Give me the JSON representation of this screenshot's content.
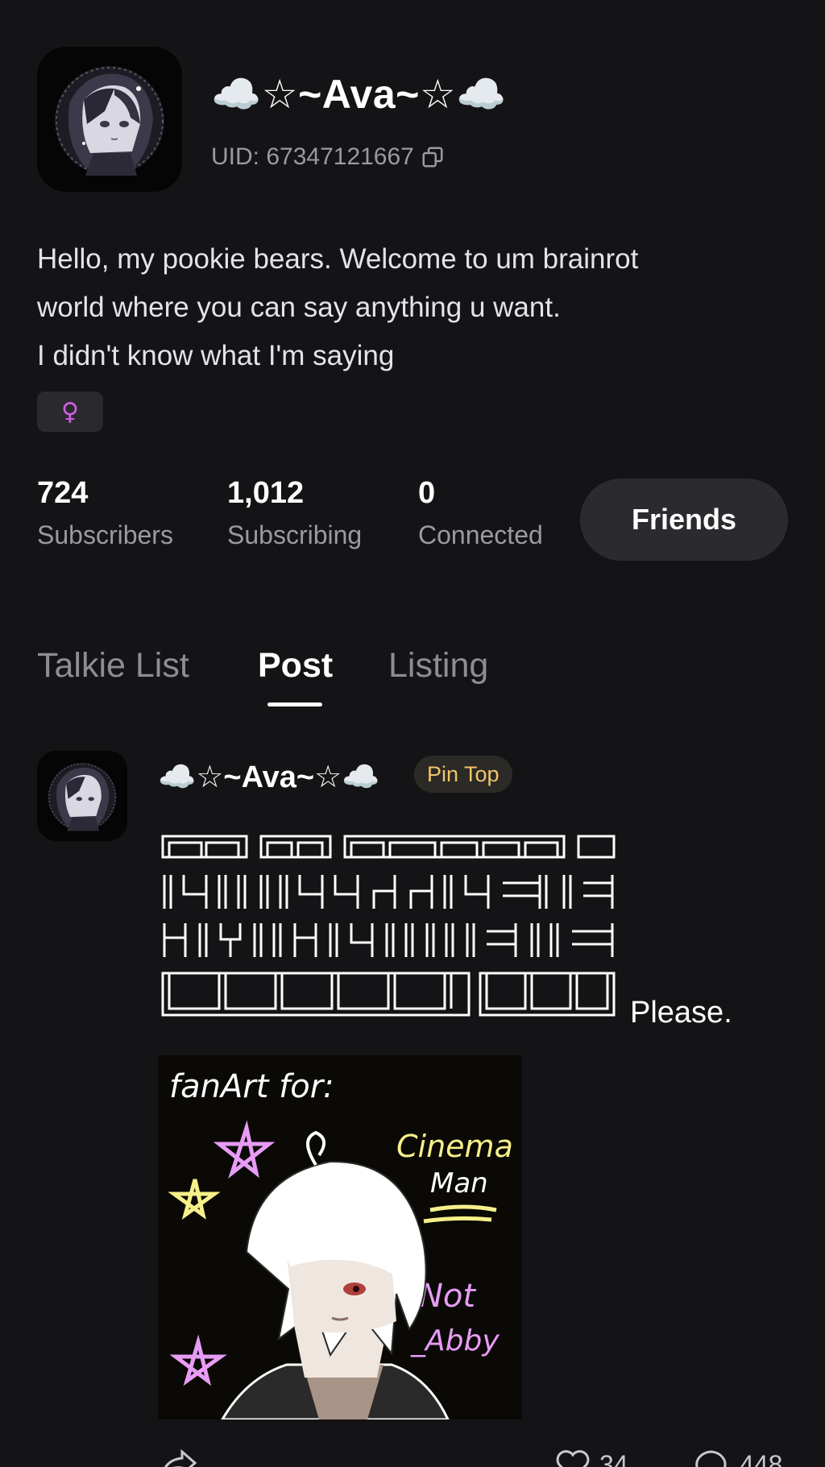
{
  "profile": {
    "username": "☁️☆~Ava~☆☁️",
    "uid": "UID: 67347121667",
    "bio_lines": [
      "Hello, my pookie bears. Welcome to um brainrot",
      "world where you can say anything u want.",
      "I didn't know what I'm saying"
    ],
    "gender_symbol": "♀",
    "gender_color": "#d25fe6"
  },
  "stats": [
    {
      "value": "724",
      "label": "Subscribers"
    },
    {
      "value": "1,012",
      "label": "Subscribing"
    },
    {
      "value": "0",
      "label": "Connected"
    }
  ],
  "friends_button": "Friends",
  "tabs": [
    {
      "label": "Talkie List",
      "active": false
    },
    {
      "label": "Post",
      "active": true
    },
    {
      "label": "Listing",
      "active": false
    }
  ],
  "post": {
    "author": "☁️☆~Ava~☆☁️",
    "pin_label": "Pin Top",
    "text_tail": "Please.",
    "image_texts": {
      "line1": "fanArt for:",
      "line2": "Cinema",
      "line3": "Man",
      "line4": "Not",
      "line5": "_Abby"
    },
    "likes": "34",
    "comments": "448"
  },
  "colors": {
    "background": "#141416",
    "pin_text": "#f0c36a",
    "muted": "#9a9aa0"
  },
  "icons": {
    "copy": "copy-icon",
    "share": "share-icon",
    "like": "heart-icon",
    "comment": "comment-icon"
  }
}
